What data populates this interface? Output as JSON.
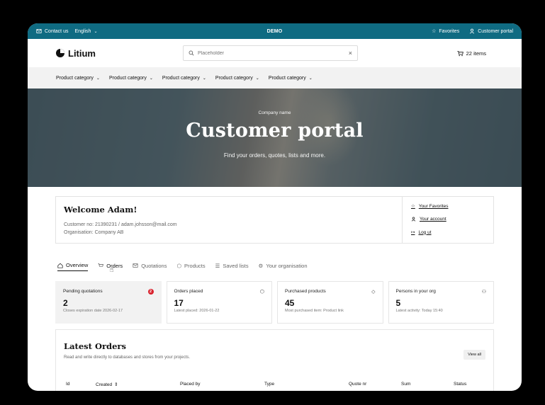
{
  "topbar": {
    "contact": "Contact us",
    "language": "English",
    "center": "DEMO",
    "favorites": "Favorites",
    "portal": "Customer portal"
  },
  "header": {
    "logo": "Litium",
    "search_placeholder": "Placeholder",
    "cart": "22 items"
  },
  "categories": [
    "Product category",
    "Product category",
    "Product category",
    "Product category",
    "Product category"
  ],
  "hero": {
    "company": "Company name",
    "title": "Customer portal",
    "subtitle": "Find your orders, quotes, lists and more."
  },
  "welcome": {
    "title": "Welcome Adam!",
    "customer": "Customer no: 21390231 / adam.johsson@mail.com",
    "organisation": "Organisation: Company AB",
    "links": [
      "Your Favorites",
      "Your account",
      "Log ut"
    ]
  },
  "tabs": [
    "Overview",
    "Orders",
    "Quotations",
    "Products",
    "Saved lists",
    "Your organisation"
  ],
  "stats": [
    {
      "label": "Pending quotations",
      "value": "2",
      "note": "Closes expiration date 2026-02-17",
      "badge": "2"
    },
    {
      "label": "Orders placed",
      "value": "17",
      "note": "Latest placed: 2026-01-22"
    },
    {
      "label": "Purchased products",
      "value": "45",
      "note": "Most purchased item: Product link"
    },
    {
      "label": "Persons in your org",
      "value": "5",
      "note": "Latest activity: Today 15:40"
    }
  ],
  "orders": {
    "title": "Latest Orders",
    "desc": "Read and write directly to databases and stores from your projects.",
    "view_all": "View all",
    "columns": [
      "Id",
      "Created",
      "Placed by",
      "Type",
      "Quote nr",
      "Sum",
      "Status"
    ]
  }
}
